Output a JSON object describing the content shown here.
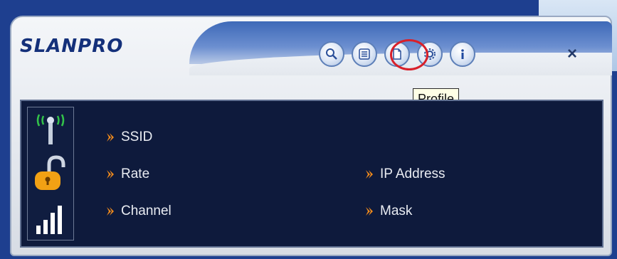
{
  "app": {
    "brand": "SLANPRO",
    "close_label": "×",
    "tooltip": "Profile"
  },
  "toolbar": {
    "buttons": [
      {
        "name": "search",
        "icon": "magnifier-icon"
      },
      {
        "name": "list",
        "icon": "list-icon"
      },
      {
        "name": "profile",
        "icon": "document-icon"
      },
      {
        "name": "settings",
        "icon": "gear-icon"
      },
      {
        "name": "info",
        "icon": "info-icon"
      }
    ],
    "highlight_color": "#d8202a"
  },
  "status": {
    "fields": [
      {
        "label": "SSID"
      },
      {
        "label": "Rate"
      },
      {
        "label": "Channel"
      },
      {
        "label": "IP Address"
      },
      {
        "label": "Mask"
      }
    ],
    "icons": [
      "wifi-antenna-icon",
      "padlock-icon",
      "signal-strength-icon"
    ]
  },
  "colors": {
    "panel_bg": "#0e1a3c",
    "bullet": "#f08a1c",
    "brand": "#14307a"
  }
}
